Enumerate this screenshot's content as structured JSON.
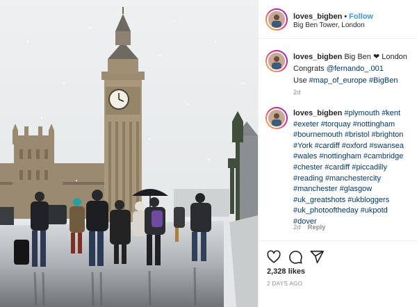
{
  "post": {
    "username": "loves_bigben",
    "follow_label": "Follow",
    "separator": "•",
    "location": "Big Ben Tower, London"
  },
  "caption": {
    "username": "loves_bigben",
    "line1_text": "Big Ben ❤ London",
    "congrats": "Congrats",
    "mention": "@fernando_.001",
    "use": "Use",
    "tags": [
      "#map_of_europe",
      "#BigBen"
    ],
    "time": "2d"
  },
  "hashtag_comment": {
    "username": "loves_bigben",
    "lines": [
      [
        "#plymouth",
        "#kent"
      ],
      [
        "#exeter",
        "#torquay",
        "#nottingham"
      ],
      [
        "#bournemouth",
        "#bristol",
        "#brighton"
      ],
      [
        "#York",
        "#cardiff",
        "#oxford",
        "#swansea"
      ],
      [
        "#wales",
        "#nottingham",
        "#cambridge"
      ],
      [
        "#chester",
        "#cardiff",
        "#piccadilly"
      ],
      [
        "#reading",
        "#manchestercity"
      ],
      [
        "#manchester",
        "#glasgow"
      ],
      [
        "#uk_greatshots",
        "#ukbloggers"
      ],
      [
        "#uk_photooftheday",
        "#ukpotd"
      ],
      [
        "#dover"
      ]
    ],
    "time": "2d",
    "reply_label": "Reply"
  },
  "actions": {
    "icons": [
      "heart-icon",
      "comment-icon",
      "share-icon"
    ],
    "likes": "2,328 likes",
    "posted": "2 DAYS AGO"
  },
  "colors": {
    "link_blue": "#3897f0",
    "hashtag": "#00376b",
    "secondary": "#8e8e8e",
    "border": "#efefef"
  }
}
